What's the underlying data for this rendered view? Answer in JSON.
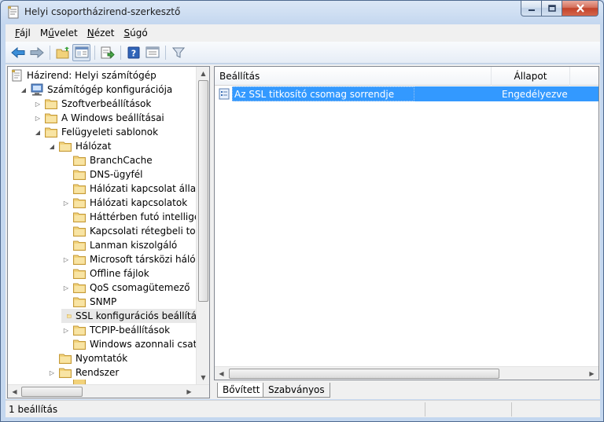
{
  "window": {
    "title": "Helyi csoportházirend-szerkesztő"
  },
  "menu": {
    "items": [
      {
        "accel": "F",
        "rest": "ájl"
      },
      {
        "pre": "M",
        "accel": "ű",
        "rest": "velet",
        "label": "Művelet"
      },
      {
        "accel": "N",
        "rest": "ézet"
      },
      {
        "accel": "S",
        "rest": "úgó"
      }
    ]
  },
  "toolbar": {
    "icons": [
      "back-arrow-icon",
      "forward-arrow-icon",
      "up-folder-icon",
      "show-hide-tree-icon",
      "export-list-icon",
      "help-icon",
      "properties-pane-icon",
      "filter-icon"
    ]
  },
  "tree": {
    "items": [
      {
        "label": "Házirend: Helyi számítógép",
        "level": 0,
        "twisty": "",
        "icon": "policy"
      },
      {
        "label": "Számítógép konfigurációja",
        "level": 1,
        "twisty": "open",
        "icon": "computer"
      },
      {
        "label": "Szoftverbeállítások",
        "level": 2,
        "twisty": "closed",
        "icon": "folder"
      },
      {
        "label": "A Windows beállításai",
        "level": 2,
        "twisty": "closed",
        "icon": "folder"
      },
      {
        "label": "Felügyeleti sablonok",
        "level": 2,
        "twisty": "open",
        "icon": "folder"
      },
      {
        "label": "Hálózat",
        "level": 3,
        "twisty": "open",
        "icon": "folder"
      },
      {
        "label": "BranchCache",
        "level": 4,
        "twisty": "",
        "icon": "folder"
      },
      {
        "label": "DNS-ügyfél",
        "level": 4,
        "twisty": "",
        "icon": "folder"
      },
      {
        "label": "Hálózati kapcsolat állapot",
        "level": 4,
        "twisty": "",
        "icon": "folder"
      },
      {
        "label": "Hálózati kapcsolatok",
        "level": 4,
        "twisty": "closed",
        "icon": "folder"
      },
      {
        "label": "Háttérben futó intelligens",
        "level": 4,
        "twisty": "",
        "icon": "folder"
      },
      {
        "label": "Kapcsolati rétegbeli topol",
        "level": 4,
        "twisty": "",
        "icon": "folder"
      },
      {
        "label": "Lanman kiszolgáló",
        "level": 4,
        "twisty": "",
        "icon": "folder"
      },
      {
        "label": "Microsoft társközi hálózat",
        "level": 4,
        "twisty": "closed",
        "icon": "folder"
      },
      {
        "label": "Offline fájlok",
        "level": 4,
        "twisty": "",
        "icon": "folder"
      },
      {
        "label": "QoS csomagütemező",
        "level": 4,
        "twisty": "closed",
        "icon": "folder"
      },
      {
        "label": "SNMP",
        "level": 4,
        "twisty": "",
        "icon": "folder"
      },
      {
        "label": "SSL konfigurációs beállítá",
        "level": 4,
        "twisty": "",
        "icon": "folder",
        "selected": true
      },
      {
        "label": "TCPIP-beállítások",
        "level": 4,
        "twisty": "closed",
        "icon": "folder"
      },
      {
        "label": "Windows azonnali csatlak",
        "level": 4,
        "twisty": "",
        "icon": "folder"
      },
      {
        "label": "Nyomtatók",
        "level": 3,
        "twisty": "",
        "icon": "folder"
      },
      {
        "label": "Rendszer",
        "level": 3,
        "twisty": "closed",
        "icon": "folder"
      }
    ]
  },
  "list": {
    "columns": [
      {
        "label": "Beállítás"
      },
      {
        "label": "Állapot"
      }
    ],
    "rows": [
      {
        "setting": "Az SSL titkosító csomag sorrendje",
        "state": "Engedélyezve",
        "selected": true
      }
    ]
  },
  "tabs": [
    {
      "label": "Bővített",
      "active": true
    },
    {
      "label": "Szabványos",
      "active": false
    }
  ],
  "status": {
    "text": "1 beállítás"
  },
  "colors": {
    "selection": "#3399ff",
    "folder": "#f2d27a"
  }
}
